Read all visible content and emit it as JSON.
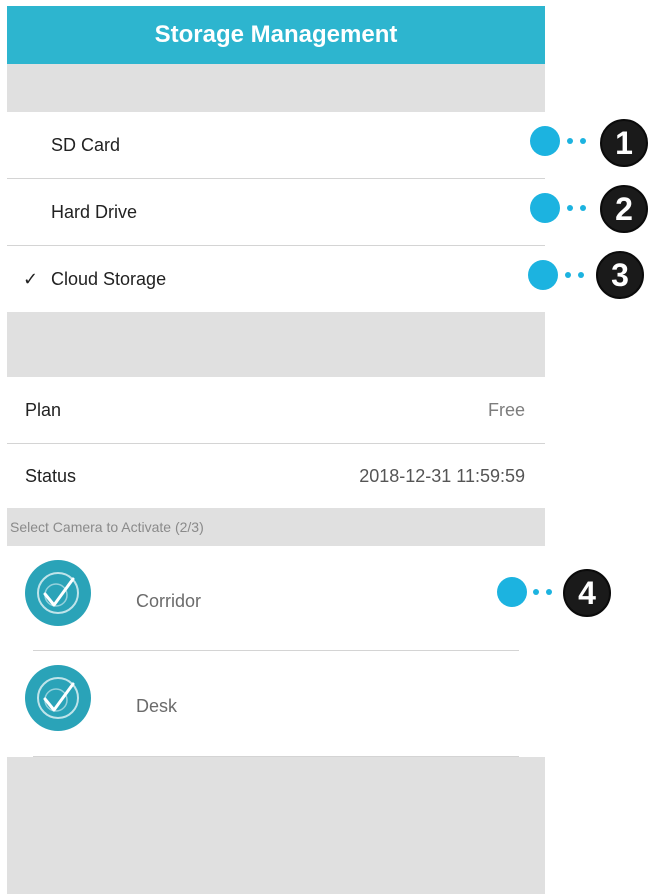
{
  "header": {
    "title": "Storage Management"
  },
  "storage_options": [
    {
      "label": "SD Card",
      "selected": false
    },
    {
      "label": "Hard Drive",
      "selected": false
    },
    {
      "label": "Cloud Storage",
      "selected": true,
      "check": "✓"
    }
  ],
  "plan": {
    "label": "Plan",
    "value": "Free"
  },
  "status": {
    "label": "Status",
    "value": "2018-12-31 11:59:59"
  },
  "camera_section": {
    "title": "Select Camera to Activate (2/3)"
  },
  "cameras": [
    {
      "name": "Corridor",
      "icon": "camera-check-icon"
    },
    {
      "name": "Desk",
      "icon": "camera-check-icon"
    }
  ],
  "callouts": [
    "1",
    "2",
    "3",
    "4"
  ],
  "colors": {
    "header": "#2db5cf",
    "avatar": "#2aa3b8",
    "callout_dot": "#1cb3e0",
    "gray": "#e0e0e0"
  }
}
